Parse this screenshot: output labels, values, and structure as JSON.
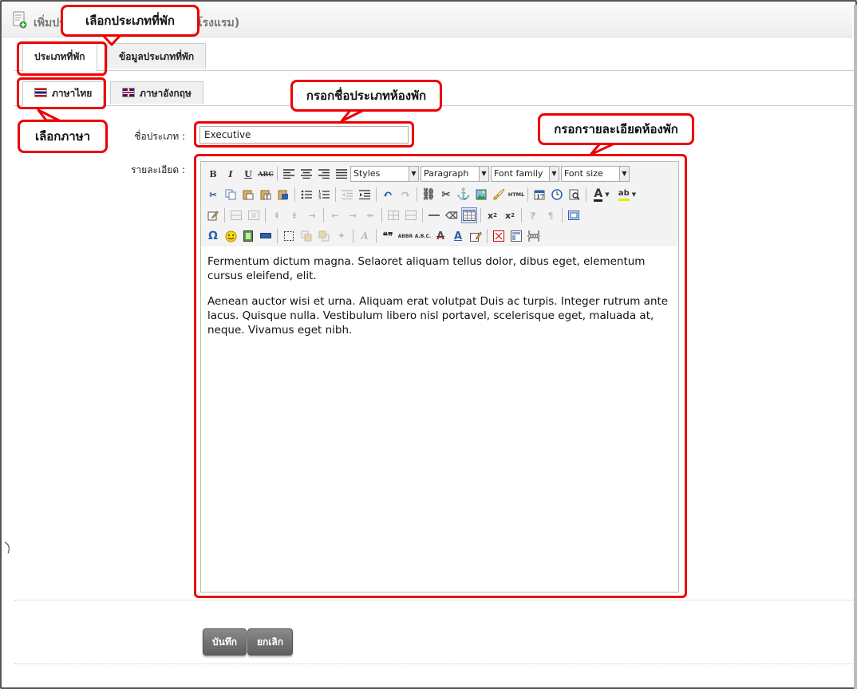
{
  "header": {
    "title": "เพิ่มประเภทที่พัก (บ้านพัก/รีสอร์ท/โรงแรม)"
  },
  "tabs_main": [
    {
      "label": "ประเภทที่พัก"
    },
    {
      "label": "ข้อมูลประเภทที่พัก"
    }
  ],
  "tabs_lang": [
    {
      "label": "ภาษาไทย"
    },
    {
      "label": "ภาษาอังกฤษ"
    }
  ],
  "form": {
    "name_label": "ชื่อประเภท :",
    "name_value": "Executive",
    "detail_label": "รายละเอียด :"
  },
  "editor": {
    "styles_select": "Styles",
    "format_select": "Paragraph",
    "font_family_select": "Font family",
    "font_size_select": "Font size",
    "paragraphs": [
      "Fermentum dictum magna. Selaoret aliquam tellus dolor, dibus eget, elementum cursus eleifend, elit.",
      "Aenean auctor wisi et urna. Aliquam erat volutpat Duis ac turpis. Integer rutrum ante lacus. Quisque nulla. Vestibulum libero nisl portavel, scelerisque eget, maluada at, neque. Vivamus eget nibh."
    ]
  },
  "buttons": {
    "save": "บันทึก",
    "cancel": "ยกเลิก"
  },
  "annotations": {
    "select_type": "เลือกประเภทที่พัก",
    "select_language": "เลือกภาษา",
    "enter_type_name": "กรอกชื่อประเภทห้องพัก",
    "enter_details": "กรอกรายละเอียดห้องพัก"
  },
  "colors": {
    "annotation_red": "#e00000",
    "button_gray": "#6e6e6e"
  }
}
